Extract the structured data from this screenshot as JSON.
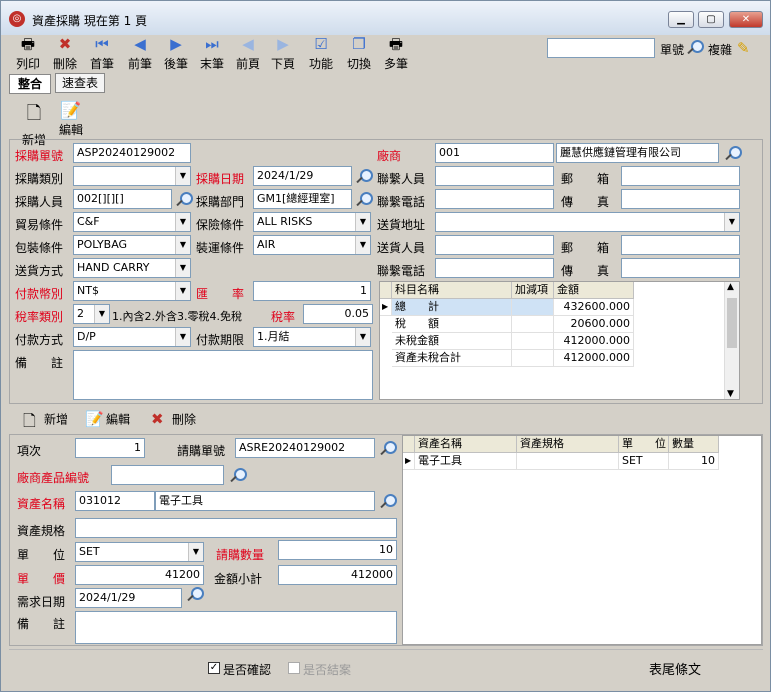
{
  "window": {
    "title": "資產採購 現在第 1 頁"
  },
  "toolbar": [
    {
      "id": "print",
      "label": "列印",
      "icon": "printer-icon"
    },
    {
      "id": "delete",
      "label": "刪除",
      "icon": "delete-icon"
    },
    {
      "id": "first",
      "label": "首筆",
      "icon": "first-icon"
    },
    {
      "id": "prev",
      "label": "前筆",
      "icon": "prev-icon"
    },
    {
      "id": "next",
      "label": "後筆",
      "icon": "next-icon"
    },
    {
      "id": "last",
      "label": "末筆",
      "icon": "last-icon"
    },
    {
      "id": "prevpage",
      "label": "前頁",
      "icon": "prev-page-icon"
    },
    {
      "id": "nextpage",
      "label": "下頁",
      "icon": "next-page-icon"
    },
    {
      "id": "function",
      "label": "功能",
      "icon": "function-icon"
    },
    {
      "id": "switch",
      "label": "切換",
      "icon": "switch-icon"
    },
    {
      "id": "multi",
      "label": "多筆",
      "icon": "multi-icon"
    }
  ],
  "search": {
    "value": "",
    "label": "單號",
    "copy_label": "複雜"
  },
  "tabs": [
    "整合",
    "速查表"
  ],
  "header_actions": {
    "new": "新增",
    "edit": "編輯"
  },
  "master": {
    "order_no_label": "採購單號",
    "order_no": "ASP20240129002",
    "type_label": "採購類別",
    "type": "",
    "date_label": "採購日期",
    "date": "2024/1/29",
    "buyer_label": "採購人員",
    "buyer": "002[][][]",
    "dept_label": "採購部門",
    "dept": "GM1[總經理室]",
    "trade_label": "貿易條件",
    "trade": "C&F",
    "insurance_label": "保險條件",
    "insurance": "ALL RISKS",
    "pack_label": "包裝條件",
    "pack": "POLYBAG",
    "ship_label": "裝運條件",
    "ship": "AIR",
    "delivery_label": "送貨方式",
    "delivery": "HAND CARRY",
    "currency_label": "付款幣別",
    "currency": "NT$",
    "rate_label": "匯　　率",
    "rate": "1",
    "taxtype_label": "稅率類別",
    "taxtype": "2",
    "taxtype_note": "1.內含2.外含3.零稅4.免稅",
    "taxrate_label": "稅率",
    "taxrate": "0.05",
    "payment_label": "付款方式",
    "payment": "D/P",
    "term_label": "付款期限",
    "term": "1.月結",
    "remark_label": "備　　註",
    "remark": "",
    "vendor_label": "廠商",
    "vendor_code": "001",
    "vendor_name": "麗慧供應鏈管理有限公司",
    "contact_label": "聯繫人員",
    "contact": "",
    "zip_label": "郵　　箱",
    "zip": "",
    "phone_label": "聯繫電話",
    "phone": "",
    "fax_label": "傳　　真",
    "fax": "",
    "address_label": "送貨地址",
    "address": "",
    "deliver_person_label": "送貨人員",
    "deliver_person": "",
    "zip2_label": "郵　　箱",
    "zip2": "",
    "phone2_label": "聯繫電話",
    "phone2": "",
    "fax2_label": "傳　　真",
    "fax2": ""
  },
  "summary": {
    "headers": [
      "科目名稱",
      "加減項",
      "金額"
    ],
    "rows": [
      {
        "name": "總　　計",
        "adj": "",
        "amount": "432600.000"
      },
      {
        "name": "稅　　額",
        "adj": "",
        "amount": "20600.000"
      },
      {
        "name": "未稅金額",
        "adj": "",
        "amount": "412000.000"
      },
      {
        "name": "資產未稅合計",
        "adj": "",
        "amount": "412000.000"
      }
    ]
  },
  "detail_actions": {
    "new": "新增",
    "edit": "編輯",
    "delete": "刪除"
  },
  "detail": {
    "item_label": "項次",
    "item": "1",
    "req_no_label": "請購單號",
    "req_no": "ASRE20240129002",
    "vendor_prod_label": "廠商產品編號",
    "vendor_prod": "",
    "asset_label": "資產名稱",
    "asset_code": "031012",
    "asset_name": "電子工具",
    "spec_label": "資產規格",
    "spec": "",
    "unit_label": "單　　位",
    "unit": "SET",
    "qty_label": "請購數量",
    "qty": "10",
    "price_label": "單　　價",
    "price": "41200",
    "subtotal_label": "金額小計",
    "subtotal": "412000",
    "need_date_label": "需求日期",
    "need_date": "2024/1/29",
    "remark_label": "備　　註",
    "remark": ""
  },
  "detail_grid": {
    "headers": [
      "資產名稱",
      "資產規格",
      "單　　位",
      "數量"
    ],
    "rows": [
      {
        "name": "電子工具",
        "spec": "",
        "unit": "SET",
        "qty": "10"
      }
    ]
  },
  "footer": {
    "confirm_label": "是否確認",
    "closed_label": "是否結案",
    "tail_label": "表尾條文"
  },
  "colors": {
    "required": "#e0001a",
    "window_bg": "#d4d0c8"
  }
}
